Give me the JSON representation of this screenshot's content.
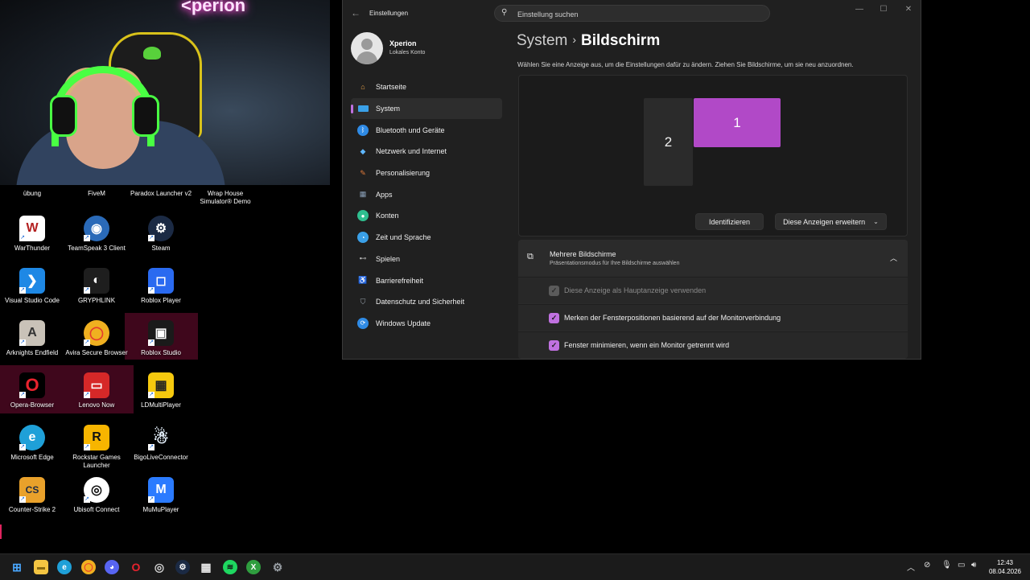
{
  "settings": {
    "title": "Einstellungen",
    "search_placeholder": "Einstellung suchen",
    "profile": {
      "name": "Xperion",
      "account_type": "Lokales Konto"
    },
    "nav": [
      {
        "label": "Startseite",
        "icon": "home-icon",
        "color": "#e8a34a"
      },
      {
        "label": "System",
        "icon": "monitor-icon",
        "color": "#3aa0e8",
        "active": true
      },
      {
        "label": "Bluetooth und Geräte",
        "icon": "bluetooth-icon",
        "color": "#2f8be6"
      },
      {
        "label": "Netzwerk und Internet",
        "icon": "wifi-icon",
        "color": "#5fb7ff"
      },
      {
        "label": "Personalisierung",
        "icon": "brush-icon",
        "color": "#e07a3a"
      },
      {
        "label": "Apps",
        "icon": "apps-icon",
        "color": "#8aa0b8"
      },
      {
        "label": "Konten",
        "icon": "person-icon",
        "color": "#2fbf8f"
      },
      {
        "label": "Zeit und Sprache",
        "icon": "globe-clock-icon",
        "color": "#3aa0e8"
      },
      {
        "label": "Spielen",
        "icon": "gamepad-icon",
        "color": "#b0b0b0"
      },
      {
        "label": "Barrierefreiheit",
        "icon": "accessibility-icon",
        "color": "#3a8be8"
      },
      {
        "label": "Datenschutz und Sicherheit",
        "icon": "shield-icon",
        "color": "#9aa4ae"
      },
      {
        "label": "Windows Update",
        "icon": "sync-icon",
        "color": "#2f8be6"
      }
    ],
    "breadcrumb": {
      "parent": "System",
      "current": "Bildschirm"
    },
    "description": "Wählen Sie eine Anzeige aus, um die Einstellungen dafür zu ändern. Ziehen Sie Bildschirme, um sie neu anzuordnen.",
    "monitors": {
      "primary": "1",
      "secondary": "2",
      "accent": "#b149c7"
    },
    "identify_label": "Identifizieren",
    "extend_label": "Diese Anzeigen erweitern",
    "multi": {
      "title": "Mehrere Bildschirme",
      "subtitle": "Präsentationsmodus für Ihre Bildschirme auswählen",
      "options": [
        {
          "label": "Diese Anzeige als Hauptanzeige verwenden",
          "checked": true,
          "disabled": true
        },
        {
          "label": "Merken der Fensterpositionen basierend auf der Monitorverbindung",
          "checked": true,
          "disabled": false
        },
        {
          "label": "Fenster minimieren, wenn ein Monitor getrennt wird",
          "checked": true,
          "disabled": false
        }
      ]
    }
  },
  "webcam": {
    "neon_text": "<perion"
  },
  "desktop": {
    "top_labels": [
      "übung",
      "FiveM",
      "Paradox Launcher v2",
      "Wrap House Simulator® Demo"
    ],
    "icons": [
      {
        "label": "WarThunder",
        "icon": "warthunder-icon",
        "color": "#ffffff",
        "glyph": "W"
      },
      {
        "label": "TeamSpeak 3 Client",
        "icon": "teamspeak-icon",
        "color": "#2a6ab8",
        "glyph": "◉"
      },
      {
        "label": "Steam",
        "icon": "steam-icon",
        "color": "#1b2a44",
        "glyph": "⚙"
      },
      {
        "label": "Visual Studio Code",
        "icon": "vscode-icon",
        "color": "#1e88e5",
        "glyph": "❯"
      },
      {
        "label": "GRYPHLINK",
        "icon": "gryphlink-icon",
        "color": "#1e1e1e",
        "glyph": "◐"
      },
      {
        "label": "Roblox Player",
        "icon": "roblox-icon",
        "color": "#2a6af0",
        "glyph": "◻"
      },
      {
        "label": "Arknights Endfield",
        "icon": "arknights-icon",
        "color": "#c9c2b8",
        "glyph": "A"
      },
      {
        "label": "Avira Secure Browser",
        "icon": "avira-icon",
        "color": "#e63a2e",
        "glyph": "◯"
      },
      {
        "label": "Roblox Studio",
        "icon": "roblox-studio-icon",
        "color": "#1a1a1a",
        "glyph": "▣"
      },
      {
        "label": "Opera-Browser",
        "icon": "opera-icon",
        "color": "#e8232e",
        "glyph": "O"
      },
      {
        "label": "Lenovo Now",
        "icon": "lenovo-icon",
        "color": "#d62828",
        "glyph": "▭"
      },
      {
        "label": "LDMultiPlayer",
        "icon": "ldplayer-icon",
        "color": "#f6c90e",
        "glyph": "▦"
      },
      {
        "label": "Microsoft Edge",
        "icon": "edge-icon",
        "color": "#1fa0d8",
        "glyph": "e"
      },
      {
        "label": "Rockstar Games Launcher",
        "icon": "rockstar-icon",
        "color": "#f7b500",
        "glyph": "R"
      },
      {
        "label": "BigoLiveConnector",
        "icon": "bigolive-icon",
        "color": "#e8f4ff",
        "glyph": "☃"
      },
      {
        "label": "Counter-Strike 2",
        "icon": "cs2-icon",
        "color": "#e9a12b",
        "glyph": "CS"
      },
      {
        "label": "Ubisoft Connect",
        "icon": "ubisoft-icon",
        "color": "#ffffff",
        "glyph": "◎"
      },
      {
        "label": "MuMuPlayer",
        "icon": "mumu-icon",
        "color": "#2b7bff",
        "glyph": "M"
      }
    ]
  },
  "taskbar": {
    "apps": [
      {
        "icon": "start-icon",
        "color": "#4aa8ff",
        "glyph": "⊞"
      },
      {
        "icon": "file-explorer-icon",
        "color": "#f4c542",
        "glyph": "▬"
      },
      {
        "icon": "edge-icon",
        "color": "#1fa0d8",
        "glyph": "e"
      },
      {
        "icon": "avira-browser-icon",
        "color": "#e63a2e",
        "glyph": "◯"
      },
      {
        "icon": "discord-icon",
        "color": "#5865f2",
        "glyph": "◕"
      },
      {
        "icon": "opera-gx-icon",
        "color": "#e8232e",
        "glyph": "O"
      },
      {
        "icon": "ubisoft-icon",
        "color": "#d0d0d0",
        "glyph": "◎"
      },
      {
        "icon": "steam-icon",
        "color": "#1b2a44",
        "glyph": "⚙"
      },
      {
        "icon": "store-icon",
        "color": "#e8e8e8",
        "glyph": "▦"
      },
      {
        "icon": "spotify-icon",
        "color": "#1ed760",
        "glyph": "≋"
      },
      {
        "icon": "xbox-icon",
        "color": "#2f9e3f",
        "glyph": "X"
      },
      {
        "icon": "settings-icon",
        "color": "#9aa0a6",
        "glyph": "⚙"
      }
    ],
    "tray": [
      "chevron-up-icon",
      "bluetooth-off-icon",
      "microphone-icon",
      "network-icon",
      "speaker-icon"
    ],
    "time": "12:43",
    "date": "08.04.2026"
  }
}
